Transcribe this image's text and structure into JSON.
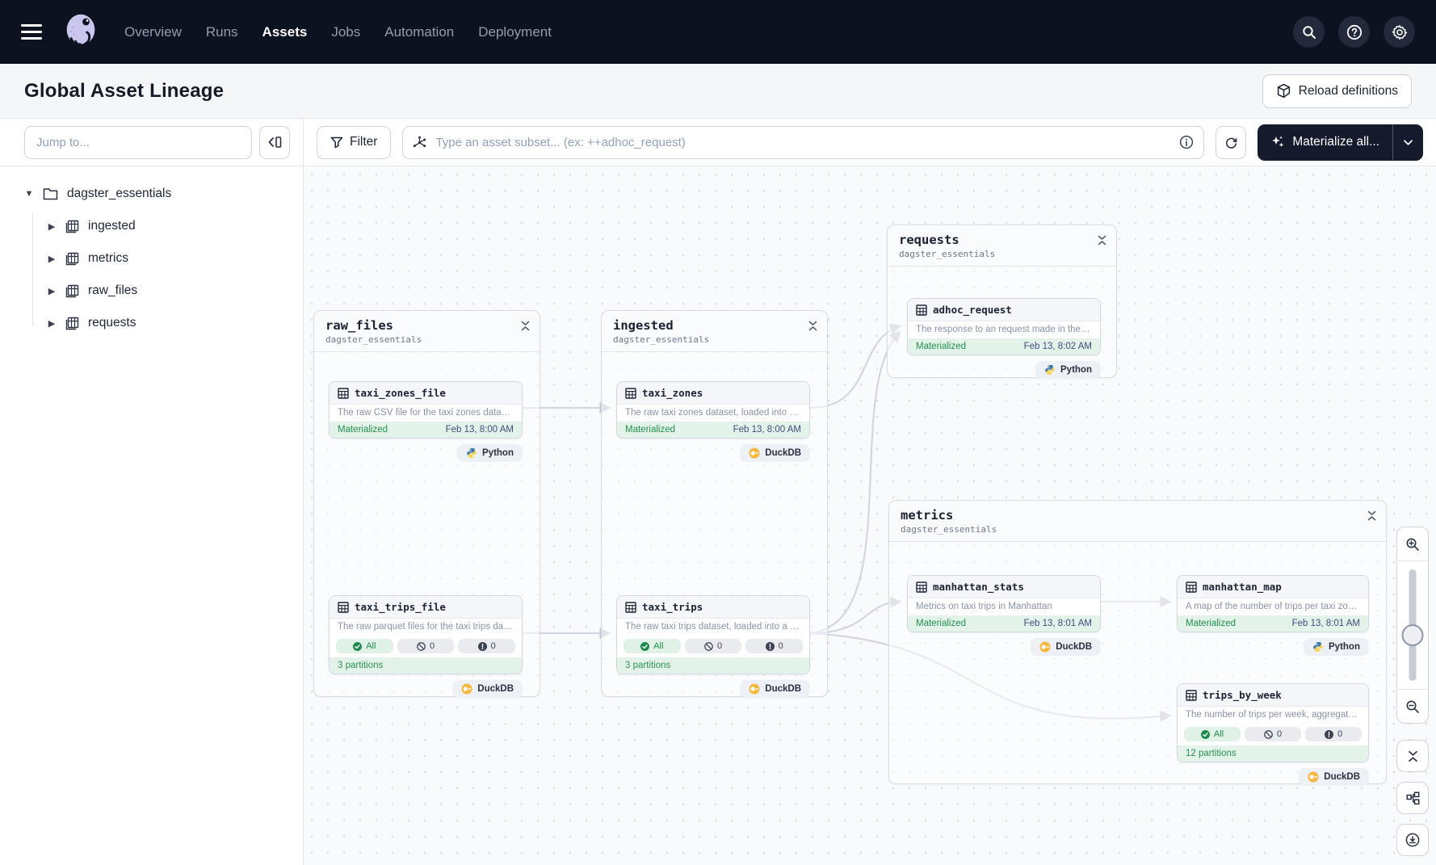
{
  "navbar": {
    "links": [
      {
        "label": "Overview"
      },
      {
        "label": "Runs"
      },
      {
        "label": "Assets"
      },
      {
        "label": "Jobs"
      },
      {
        "label": "Automation"
      },
      {
        "label": "Deployment"
      }
    ],
    "active": "Assets"
  },
  "header": {
    "title": "Global Asset Lineage",
    "reload_label": "Reload definitions"
  },
  "toolbar": {
    "jump_placeholder": "Jump to...",
    "filter_label": "Filter",
    "subset_placeholder": "Type an asset subset... (ex: ++adhoc_request)",
    "materialize_label": "Materialize all..."
  },
  "sidebar": {
    "root": {
      "label": "dagster_essentials"
    },
    "items": [
      {
        "label": "ingested"
      },
      {
        "label": "metrics"
      },
      {
        "label": "raw_files"
      },
      {
        "label": "requests"
      }
    ]
  },
  "graph": {
    "groups": [
      {
        "name": "raw_files",
        "subtitle": "dagster_essentials"
      },
      {
        "name": "ingested",
        "subtitle": "dagster_essentials"
      },
      {
        "name": "requests",
        "subtitle": "dagster_essentials"
      },
      {
        "name": "metrics",
        "subtitle": "dagster_essentials"
      }
    ],
    "assets": [
      {
        "name": "taxi_zones_file",
        "description": "The raw CSV file for the taxi zones dataset. Sour…",
        "status": "Materialized",
        "time": "Feb 13, 8:00 AM",
        "badge": "Python"
      },
      {
        "name": "taxi_trips_file",
        "description": "The raw parquet files for the taxi trips dataset. S…",
        "pills": {
          "all": "All",
          "missing": "0",
          "failed": "0"
        },
        "partitions": "3 partitions",
        "badge": "DuckDB"
      },
      {
        "name": "taxi_zones",
        "description": "The raw taxi zones dataset, loaded into a DuckD…",
        "status": "Materialized",
        "time": "Feb 13, 8:00 AM",
        "badge": "DuckDB"
      },
      {
        "name": "taxi_trips",
        "description": "The raw taxi trips dataset, loaded into a DuckDB …",
        "pills": {
          "all": "All",
          "missing": "0",
          "failed": "0"
        },
        "partitions": "3 partitions",
        "badge": "DuckDB"
      },
      {
        "name": "adhoc_request",
        "description": "The response to an request made in the requests…",
        "status": "Materialized",
        "time": "Feb 13, 8:02 AM",
        "badge": "Python"
      },
      {
        "name": "manhattan_stats",
        "description": "Metrics on taxi trips in Manhattan",
        "status": "Materialized",
        "time": "Feb 13, 8:01 AM",
        "badge": "DuckDB"
      },
      {
        "name": "manhattan_map",
        "description": "A map of the number of trips per taxi zone in Ma…",
        "status": "Materialized",
        "time": "Feb 13, 8:01 AM",
        "badge": "Python"
      },
      {
        "name": "trips_by_week",
        "description": "The number of trips per week, aggregated by we…",
        "pills": {
          "all": "All",
          "missing": "0",
          "failed": "0"
        },
        "partitions": "12 partitions",
        "badge": "DuckDB"
      }
    ]
  },
  "colors": {
    "navbar_bg": "#0d1220",
    "accent_dark": "#151b2d",
    "status_green": "#21904f",
    "status_green_bg": "#e3f3e9",
    "time_navy": "#3d4c7e",
    "python_blue": "#3b77a8",
    "python_yellow": "#f7d354",
    "duckdb_yellow": "#f5b73d"
  }
}
